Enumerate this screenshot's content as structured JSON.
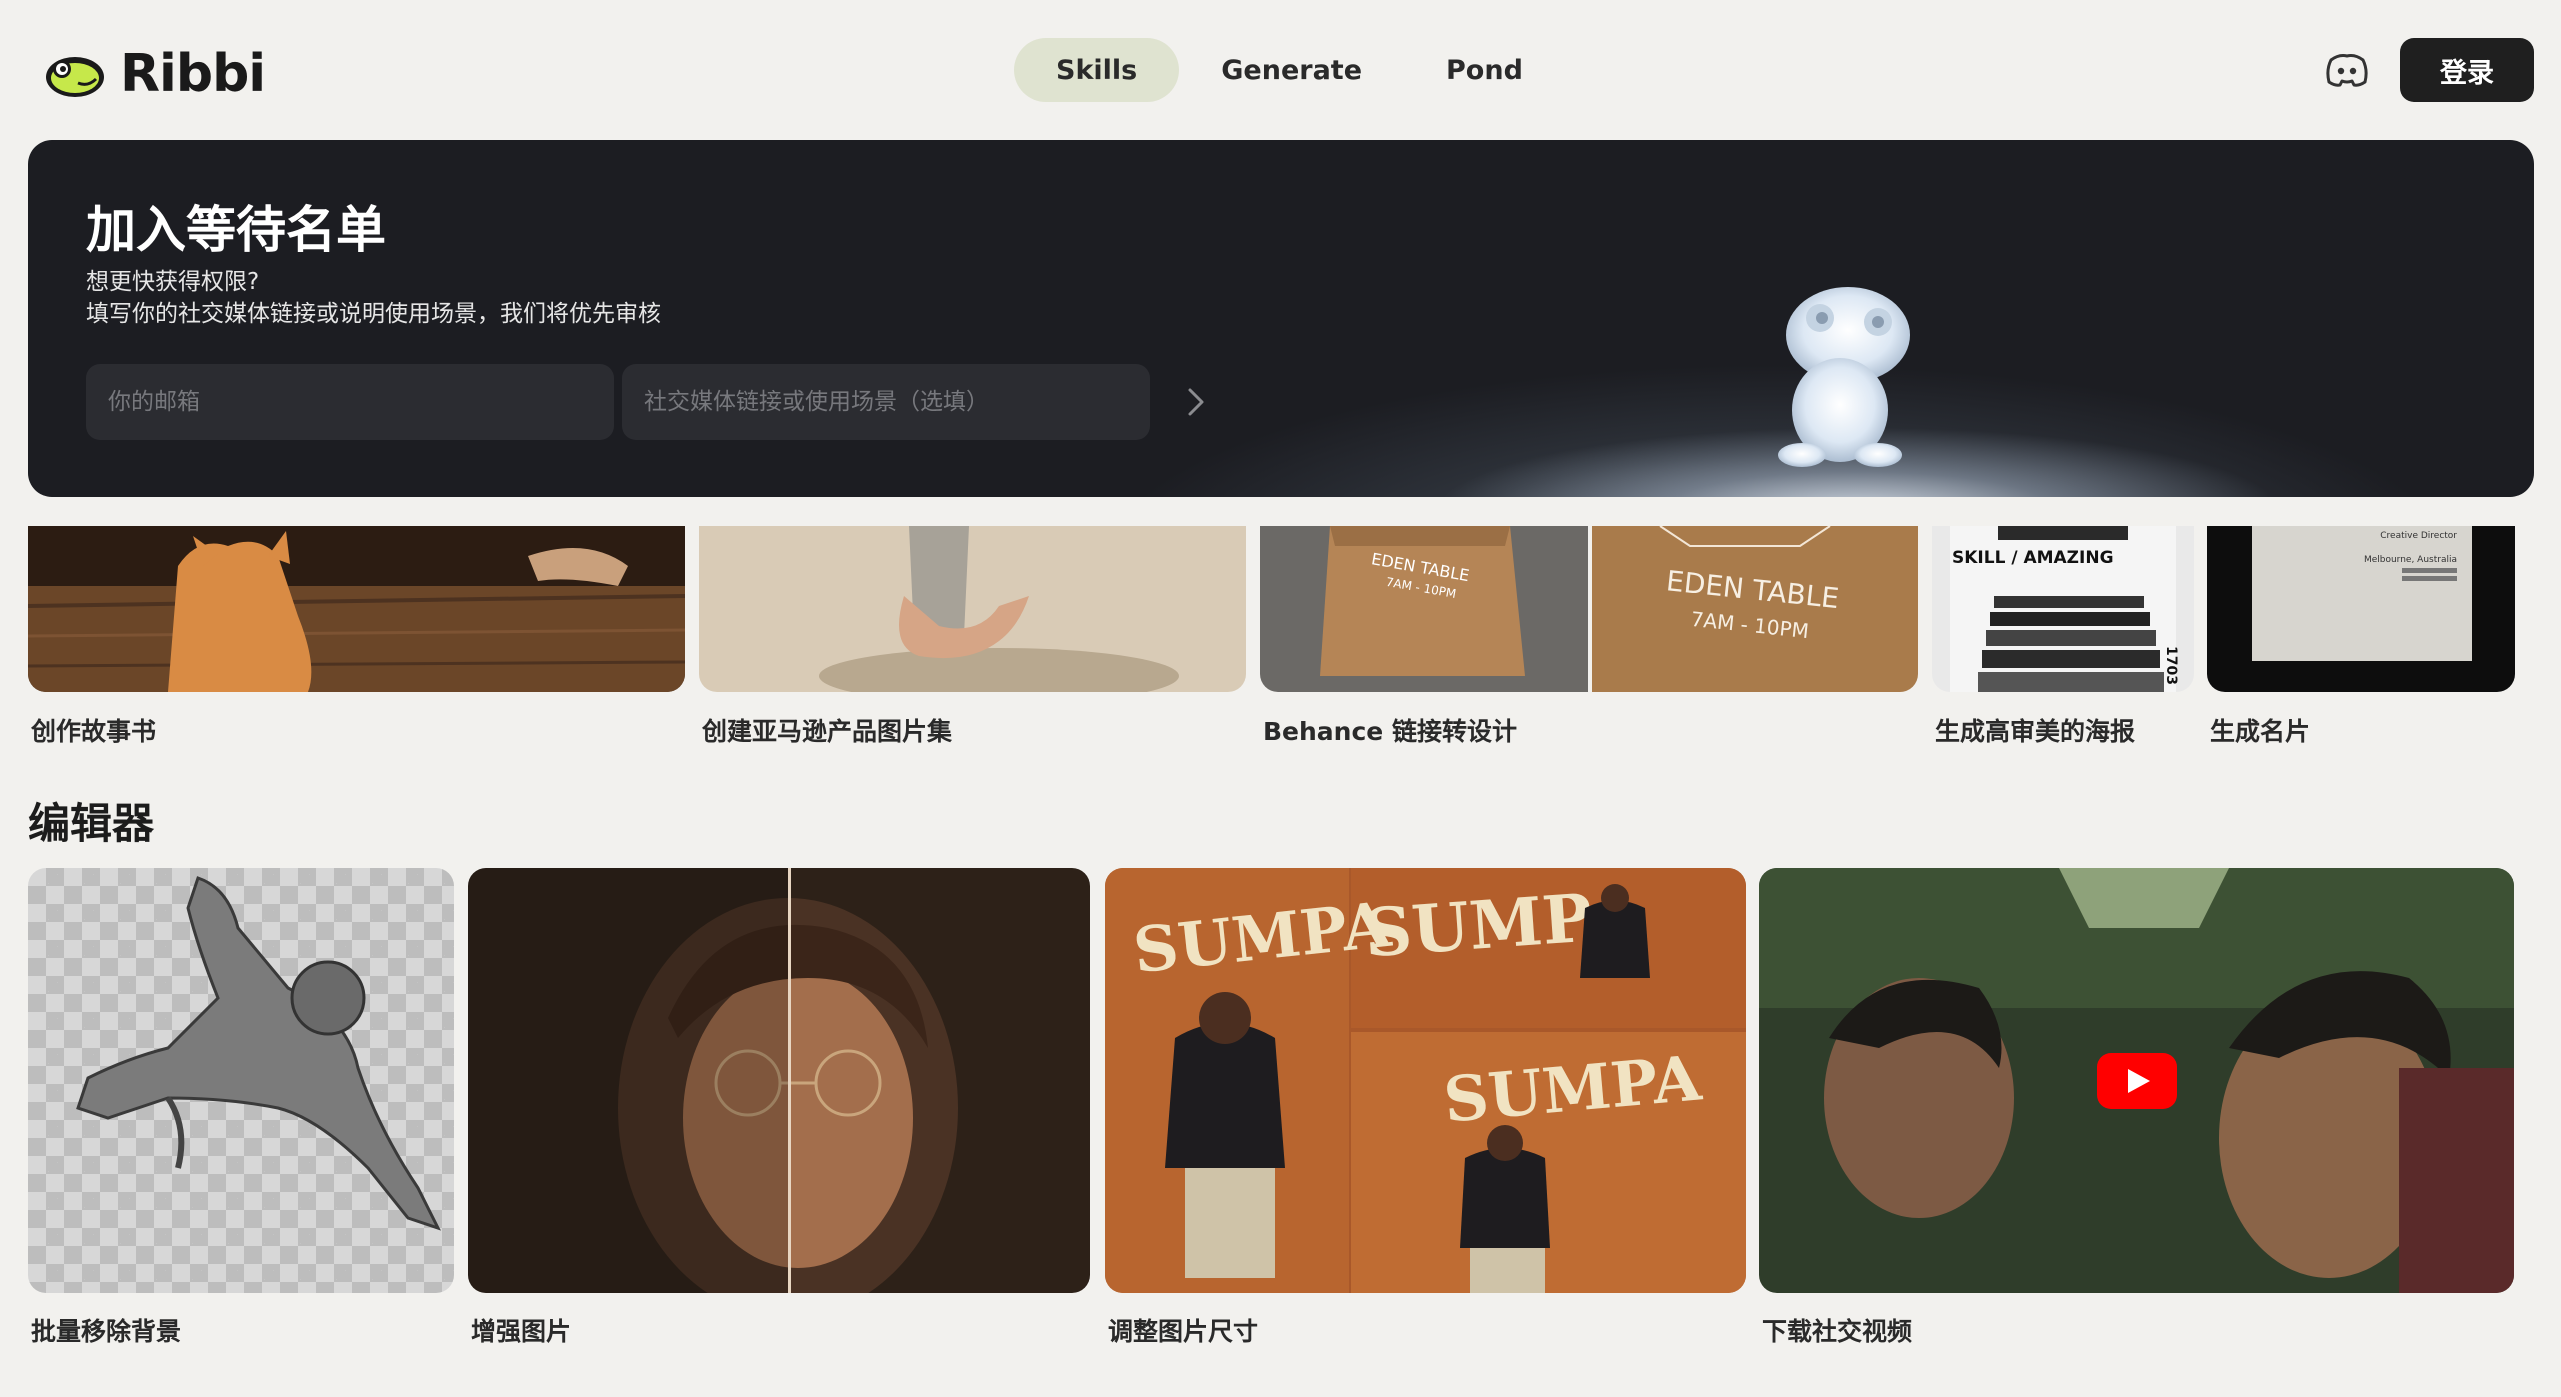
{
  "header": {
    "brand": "Ribbi",
    "nav": [
      {
        "label": "Skills",
        "active": true
      },
      {
        "label": "Generate",
        "active": false
      },
      {
        "label": "Pond",
        "active": false
      }
    ],
    "login_label": "登录"
  },
  "banner": {
    "title": "加入等待名单",
    "subtitle_line1": "想更快获得权限?",
    "subtitle_line2": "填写你的社交媒体链接或说明使用场景，我们将优先审核",
    "email_placeholder": "你的邮箱",
    "social_placeholder": "社交媒体链接或使用场景（选填）"
  },
  "skills": [
    {
      "label": "创作故事书"
    },
    {
      "label": "创建亚马逊产品图片集"
    },
    {
      "label": "Behance 链接转设计"
    },
    {
      "label": "生成高审美的海报"
    },
    {
      "label": "生成名片"
    }
  ],
  "skill_image_text": {
    "bag_small": "EDEN TABLE",
    "bag_small_hours": "7AM - 10PM",
    "bag_large": "EDEN TABLE",
    "bag_large_hours": "7AM - 10PM",
    "poster_headline": "SKILL / AMAZING",
    "poster_number": "1703",
    "card_lines": [
      "Creative Director",
      "Melbourne, Australia"
    ]
  },
  "editor": {
    "title": "编辑器",
    "items": [
      {
        "label": "批量移除背景"
      },
      {
        "label": "增强图片"
      },
      {
        "label": "调整图片尺寸"
      },
      {
        "label": "下载社交视频"
      }
    ],
    "resize_poster_word": "SUMPA"
  },
  "colors": {
    "background": "#f2f1ee",
    "nav_active": "#dfe3d0",
    "login_bg": "#1f1f1f",
    "banner_bg": "#1c1d22",
    "youtube_red": "#ff0000"
  }
}
